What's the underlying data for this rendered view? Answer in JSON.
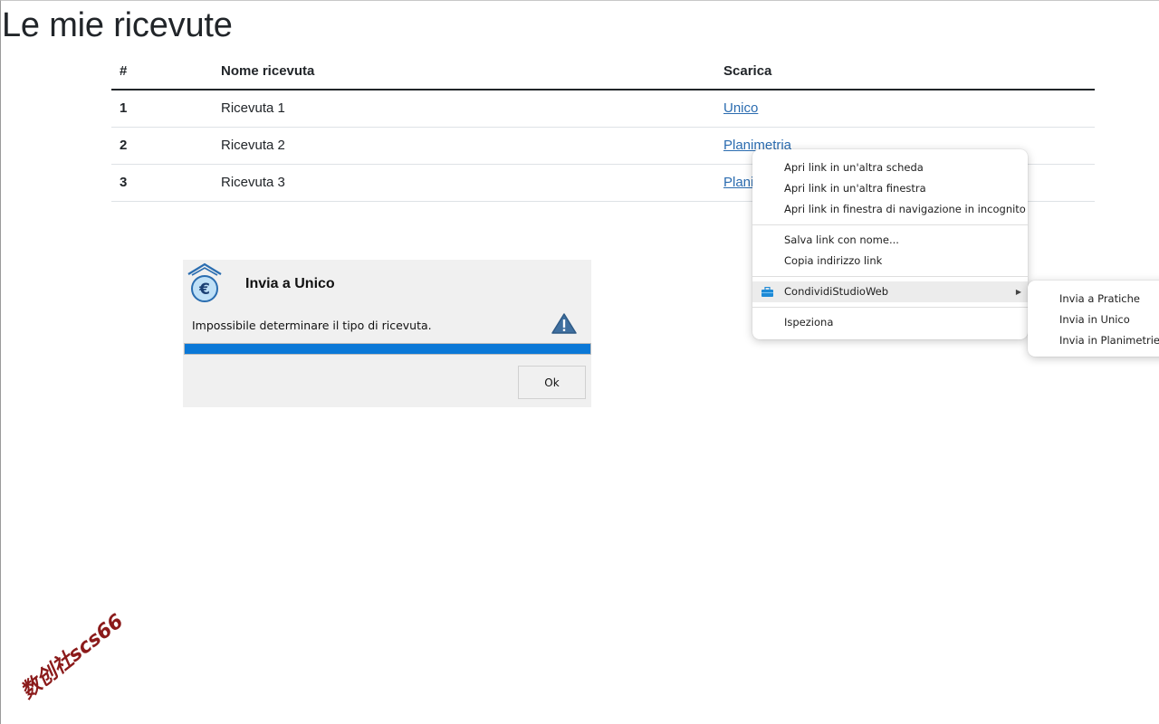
{
  "page": {
    "title": "Le mie ricevute"
  },
  "table": {
    "headers": {
      "num": "#",
      "name": "Nome ricevuta",
      "download": "Scarica"
    },
    "rows": [
      {
        "num": "1",
        "name": "Ricevuta 1",
        "link": "Unico"
      },
      {
        "num": "2",
        "name": "Ricevuta 2",
        "link": "Planimetria"
      },
      {
        "num": "3",
        "name": "Ricevuta 3",
        "link": "Planimetria"
      }
    ]
  },
  "dialog": {
    "title": "Invia a Unico",
    "message": "Impossibile determinare il tipo di ricevuta.",
    "progress_percent": 100,
    "ok_label": "Ok",
    "icons": {
      "app": "euro-house-icon",
      "warning": "warning-icon"
    }
  },
  "context_menu": {
    "open_new_tab": "Apri link in un'altra scheda",
    "open_new_window": "Apri link in un'altra finestra",
    "open_incognito": "Apri link in finestra di navigazione in incognito",
    "save_link_as": "Salva link con nome...",
    "copy_link": "Copia indirizzo link",
    "extension": "CondividiStudioWeb",
    "inspect": "Ispeziona"
  },
  "submenu": {
    "items": [
      "Invia a Pratiche",
      "Invia in Unico",
      "Invia in Planimetrie"
    ]
  },
  "watermark": "数创社scs66",
  "colors": {
    "link": "#2b6cb0",
    "progress": "#0a78d7",
    "watermark": "#8b1a1a"
  }
}
